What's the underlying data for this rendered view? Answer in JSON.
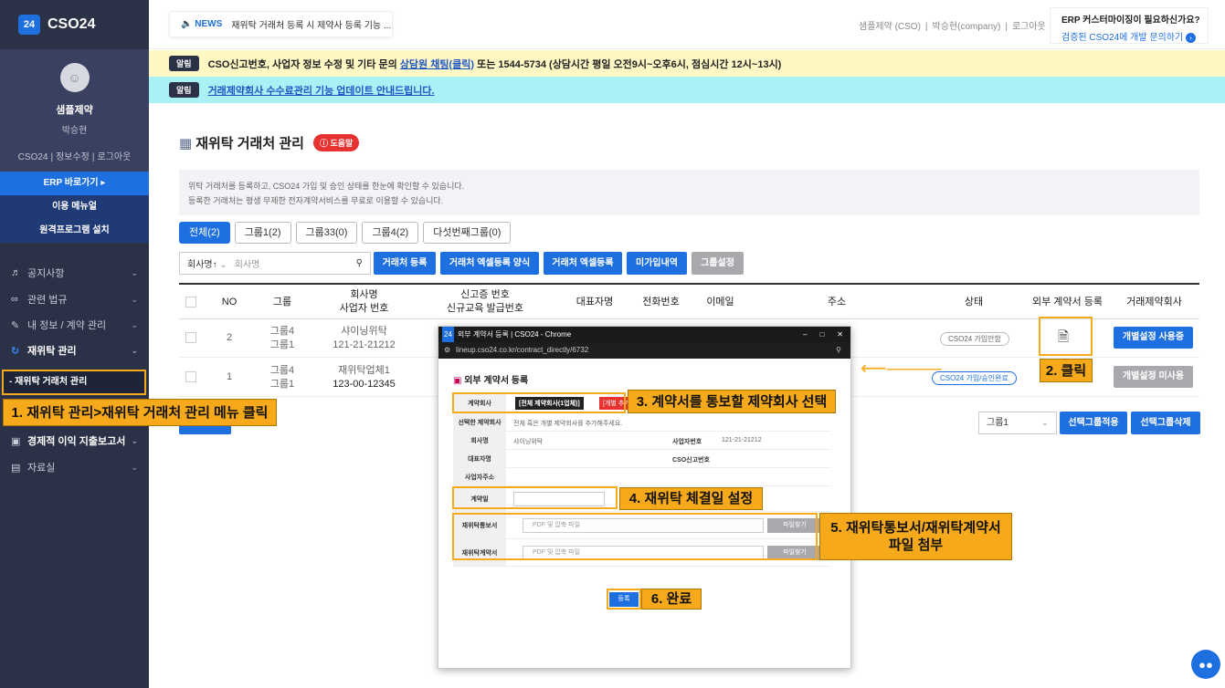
{
  "sidebar": {
    "logo_box": "24",
    "logo": "CSO24",
    "company": "샘플제약",
    "user": "박승현",
    "links": [
      "CSO24",
      "정보수정",
      "로그아웃"
    ],
    "erp": "ERP 바로가기 ▸",
    "manual": "이용 메뉴얼",
    "remote": "원격프로그램 설치",
    "menu": [
      "공지사항",
      "관련 법규",
      "내 정보 / 계약 관리",
      "재위탁 관리",
      "경제적 이익 지출보고서",
      "자료실"
    ],
    "submenu": "- 재위탁 거래처 관리"
  },
  "topbar": {
    "news_tag": "NEWS",
    "news_text": "재위탁 거래처 등록 시 제약사 등록 기능 ...",
    "company": "샘플제약 (CSO)",
    "user": "박승현(company)",
    "logout": "로그아웃",
    "promo_title": "ERP 커스터마이징이 필요하신가요?",
    "promo_link": "검증된 CSO24에 개발 문의하기"
  },
  "notices": [
    {
      "tag": "알림",
      "pre": "CSO신고번호, 사업자 정보 수정 및 기타 문의 ",
      "link": "상담원 채팅(클릭)",
      "post": " 또는 1544-5734 (상담시간 평일 오전9시~오후6시, 점심시간 12시~13시)"
    },
    {
      "tag": "알림",
      "pre": "",
      "link": "거래제약회사 수수료관리 기능 업데이트 안내드립니다.",
      "post": ""
    }
  ],
  "page": {
    "title": "재위탁 거래처 관리",
    "help": "도움말",
    "desc1": "위탁 거래처를 등록하고, CSO24 가입 및 승인 상태를 한눈에 확인할 수 있습니다.",
    "desc2": "등록한 거래처는 평생 무제한 전자계약서비스를 무료로 이용할 수 있습니다."
  },
  "tabs": [
    "전체(2)",
    "그룹1(2)",
    "그룹33(0)",
    "그룹4(2)",
    "다섯번째그룹(0)"
  ],
  "filter": {
    "select": "회사명↑",
    "placeholder": "회사명"
  },
  "buttons": [
    "거래처 등록",
    "거래처 엑셀등록 양식",
    "거래처 엑셀등록",
    "미가입내역",
    "그룹설정"
  ],
  "table": {
    "headers": {
      "no": "NO",
      "group": "그룹",
      "company1": "회사명",
      "company2": "사업자 번호",
      "report1": "신고증 번호",
      "report2": "신규교육 발급번호",
      "rep": "대표자명",
      "phone": "전화번호",
      "email": "이메일",
      "addr": "주소",
      "status": "상태",
      "ext": "외부 계약서 등록",
      "pharma": "거래제약회사"
    },
    "rows": [
      {
        "no": "2",
        "g1": "그룹4",
        "g2": "그룹1",
        "name": "샤이닝위탁",
        "biz": "121-21-21212",
        "status": "CSO24 가입안함",
        "pharma": "개별설정 사용중"
      },
      {
        "no": "1",
        "g1": "그룹4",
        "g2": "그룹1",
        "name": "재위탁업체1",
        "biz": "123-00-12345",
        "status": "CSO24 가입/승인완료",
        "pharma": "개별설정 미사용"
      }
    ]
  },
  "group_select": "그룹1",
  "apply": "선택그룹적용",
  "delete": "선택그룹삭제",
  "popup": {
    "window": "외부 계약서 등록 | CSO24 - Chrome",
    "url": "lineup.cso24.co.kr/contract_directly/6732",
    "heading": "외부 계약서 등록",
    "pharma_label": "계약회사",
    "pharma_btn": "[전체 제약회사(1업체)]",
    "add_btn": "[개별 추가]",
    "selected_label": "선택한 제약회사",
    "selected_val": "전체 혹은 개별 제약회사를 추가해주세요.",
    "name_label": "회사명",
    "name_val": "샤이닝위탁",
    "biz_label": "사업자번호",
    "biz_val": "121-21-21212",
    "rep_label": "대표자명",
    "cso_label": "CSO신고번호",
    "addr_label": "사업자주소",
    "date_label": "계약일",
    "report_label": "재위탁통보서",
    "contract_label": "재위탁계약서",
    "file_ph": "PDF 및 압축 파일",
    "find": "파일찾기",
    "submit": "등록"
  },
  "callouts": [
    "1. 재위탁 관리>재위탁 거래처 관리 메뉴 클릭",
    "2. 클릭",
    "3. 계약서를 통보할 제약회사 선택",
    "4. 재위탁 체결일 설정",
    "5. 재위탁통보서/재위탁계약서",
    "파일 첨부",
    "6. 완료"
  ]
}
